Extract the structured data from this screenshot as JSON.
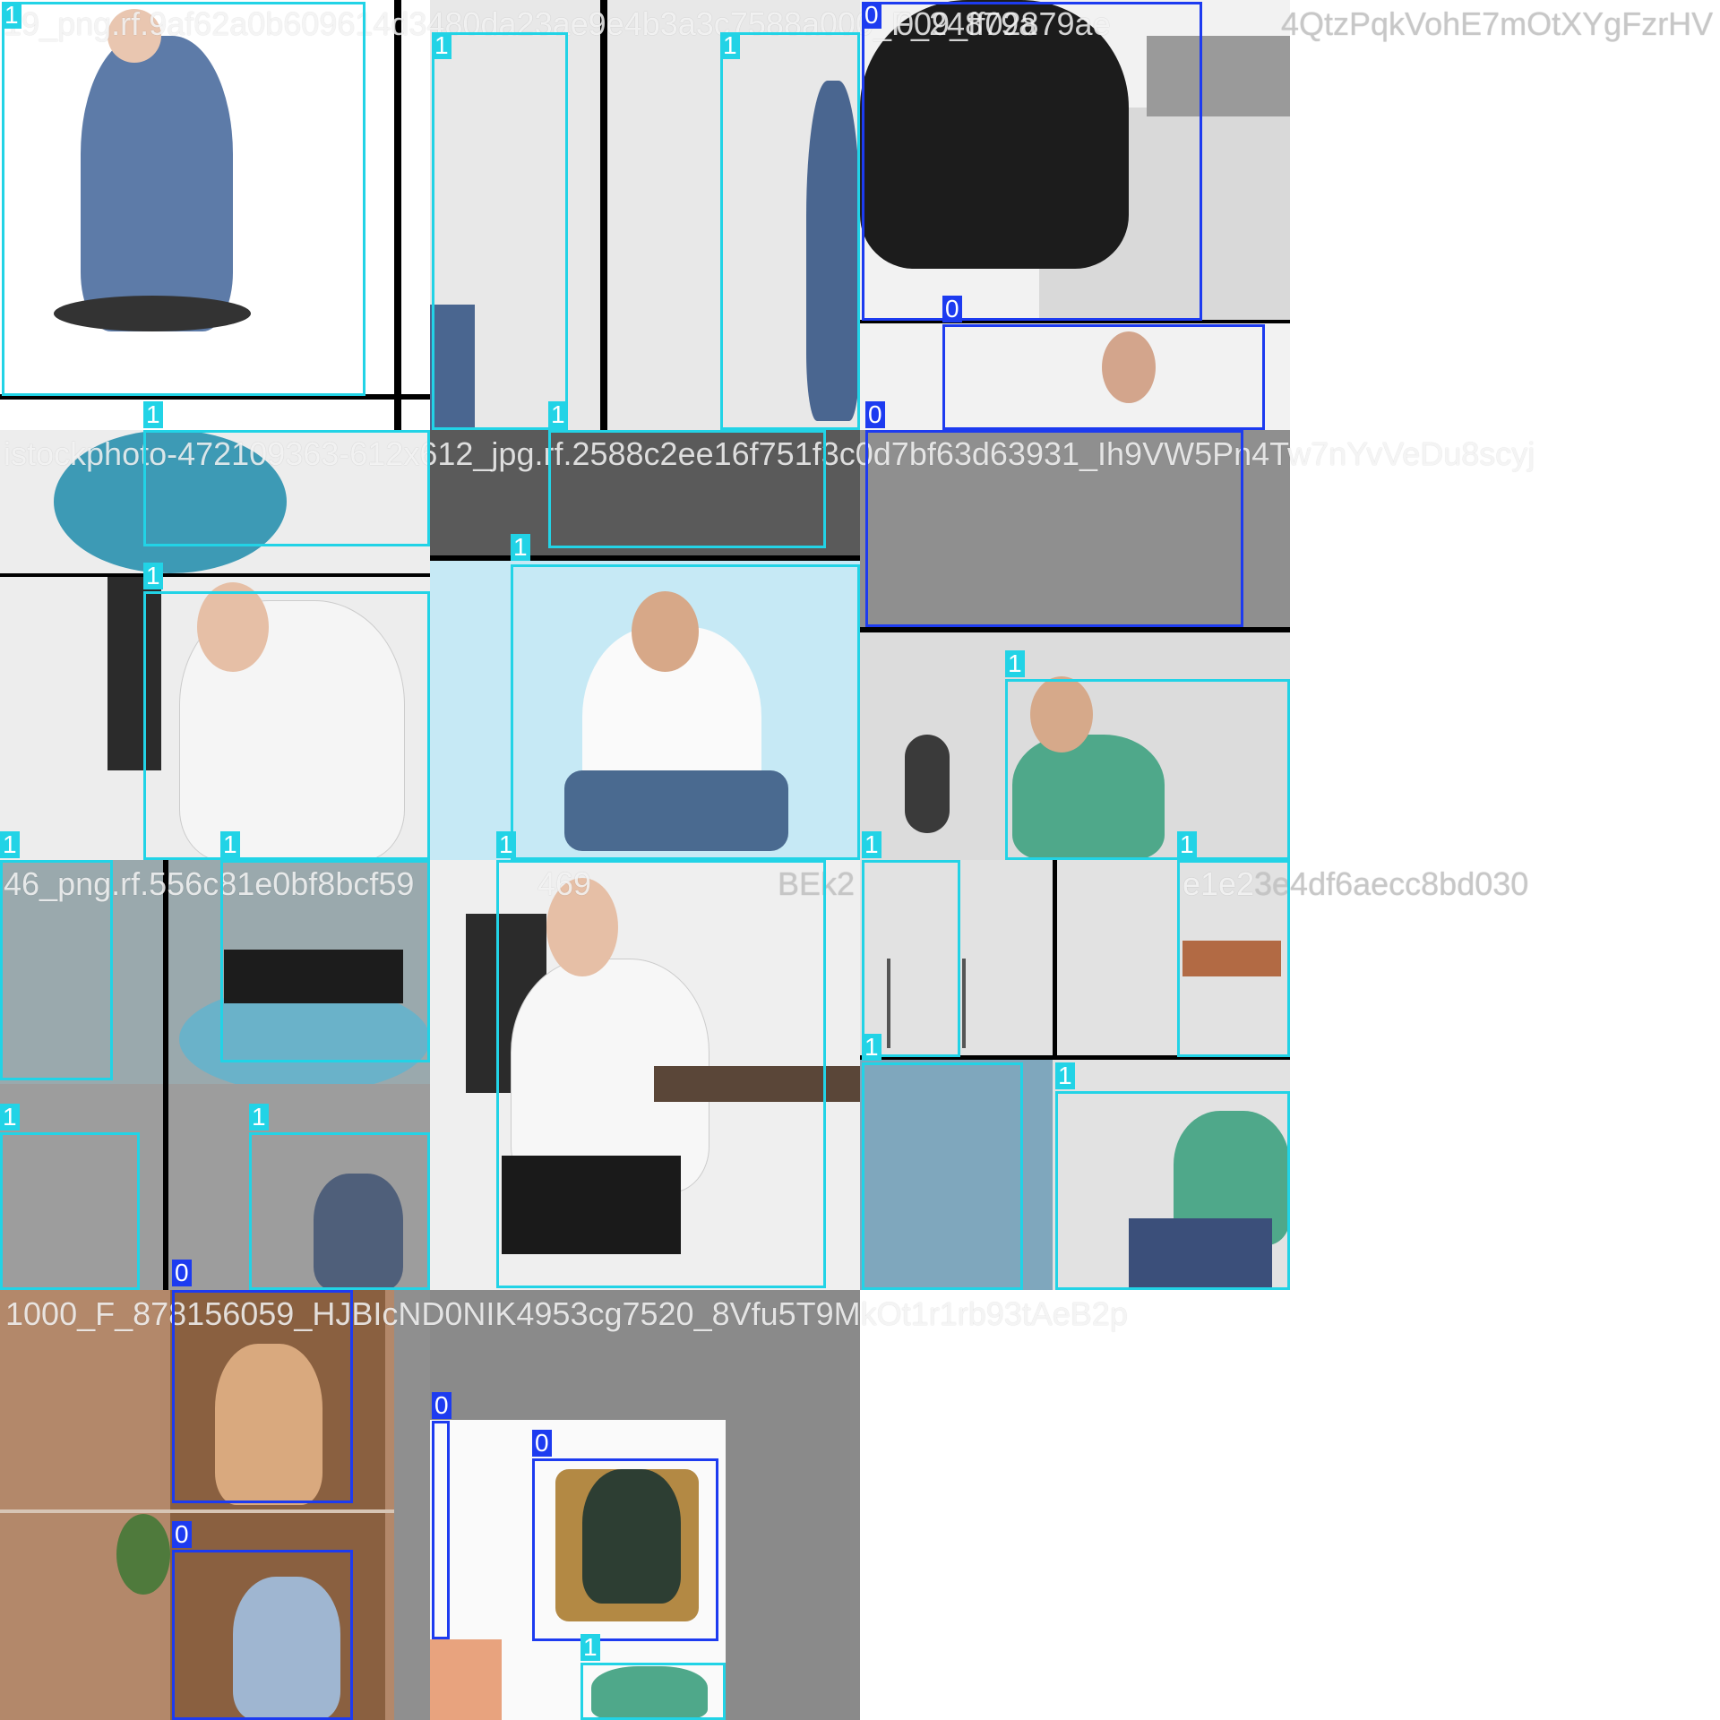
{
  "mosaic": {
    "filenames": [
      "19_png.rf.9af62a0b609614d3480da23ae9e4b3a3c7588a000_F_24879a",
      "009_ff02879ae",
      "4QtzPqkVohE7mOtXYgFzrHV",
      "istockphoto-472109363-612x612_jpg.rf.2588c2ee16f751f3c0d7bf63d63931_Ih9VW5Pn4Tw7nYvVeDu8scyj",
      "46_png.rf.556c81e0bf8bcf59",
      "469",
      "BEk2",
      "e1e2",
      "3e4df6aecc8bd030",
      "1000_F_878156059_HJBIcND0NIK4953cg7520_8Vfu5T9MkOt1r1rb93tAeB2p"
    ],
    "class_labels": [
      "0",
      "1"
    ],
    "colors": {
      "class0": "#1d3bf0",
      "class1": "#22d3e6"
    }
  }
}
